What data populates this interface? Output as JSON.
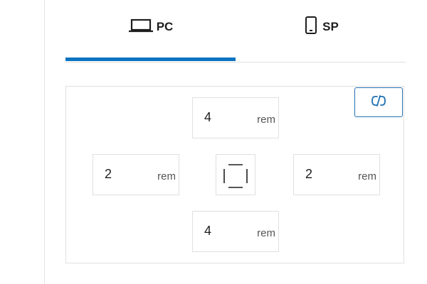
{
  "tabs": [
    {
      "label": "PC",
      "icon": "laptop-icon",
      "active": true
    },
    {
      "label": "SP",
      "icon": "smartphone-icon",
      "active": false
    }
  ],
  "accent_color": "#0a73c1",
  "link_button": {
    "icon": "unlink-icon",
    "color": "#2271b1"
  },
  "box_control": {
    "top": {
      "value": "4",
      "unit": "rem"
    },
    "left": {
      "value": "2",
      "unit": "rem"
    },
    "right": {
      "value": "2",
      "unit": "rem"
    },
    "bottom": {
      "value": "4",
      "unit": "rem"
    },
    "center_icon": "box-sides-icon"
  }
}
